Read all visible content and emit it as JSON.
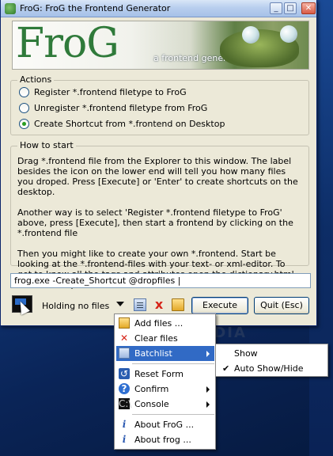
{
  "window": {
    "title": "FroG: FroG the Frontend Generator",
    "buttons": {
      "minimize": "_",
      "maximize": "□",
      "close": "✕"
    }
  },
  "banner": {
    "logo": "FroG",
    "subtitle": "a frontend generator"
  },
  "actions": {
    "label": "Actions",
    "options": [
      {
        "label": "Register *.frontend filetype to FroG",
        "checked": false
      },
      {
        "label": "Unregister *.frontend filetype from FroG",
        "checked": false
      },
      {
        "label": "Create Shortcut from *.frontend on Desktop",
        "checked": true
      }
    ]
  },
  "howto": {
    "label": "How to start",
    "paragraphs": [
      "Drag *.frontend file from the Explorer to this window. The label besides the icon on the lower end will tell you how many files you droped. Press [Execute] or 'Enter' to create shortcuts on the desktop.",
      "Another way is to select 'Register *.frontend filetype to FroG' above, press [Execute], then start a frontend by clicking on the *.frontend file",
      "Then you might like to create your own *.frontend. Start be looking at the *.frontend-files with your text- or xml-editor. To get to know all the tags and attributes open the dictionary.html from the help folder."
    ]
  },
  "command": {
    "value": "frog.exe -Create_Shortcut @dropfiles |"
  },
  "status": {
    "text": "Holding no files"
  },
  "toolbar": {
    "list_icon": "list-icon",
    "clear_icon": "x",
    "folder_icon": "folder-icon",
    "execute_label": "Execute",
    "quit_label": "Quit (Esc)"
  },
  "menu": {
    "items": [
      {
        "label": "Add files ...",
        "icon": "📂",
        "submenu": false
      },
      {
        "label": "Clear files",
        "icon": "✕",
        "submenu": false
      },
      {
        "label": "Batchlist",
        "icon": "≡",
        "submenu": true,
        "highlight": true
      },
      {
        "label": "Reset Form",
        "icon": "↺",
        "submenu": false
      },
      {
        "label": "Confirm",
        "icon": "?",
        "submenu": true
      },
      {
        "label": "Console",
        "icon": "C:\\",
        "submenu": true
      },
      {
        "label": "About FroG ...",
        "icon": "i",
        "submenu": false
      },
      {
        "label": "About frog ...",
        "icon": "i",
        "submenu": false
      }
    ]
  },
  "submenu": {
    "items": [
      {
        "label": "Show",
        "checked": false
      },
      {
        "label": "Auto Show/Hide",
        "checked": true
      }
    ]
  },
  "watermark": "SOFTPEDIA"
}
